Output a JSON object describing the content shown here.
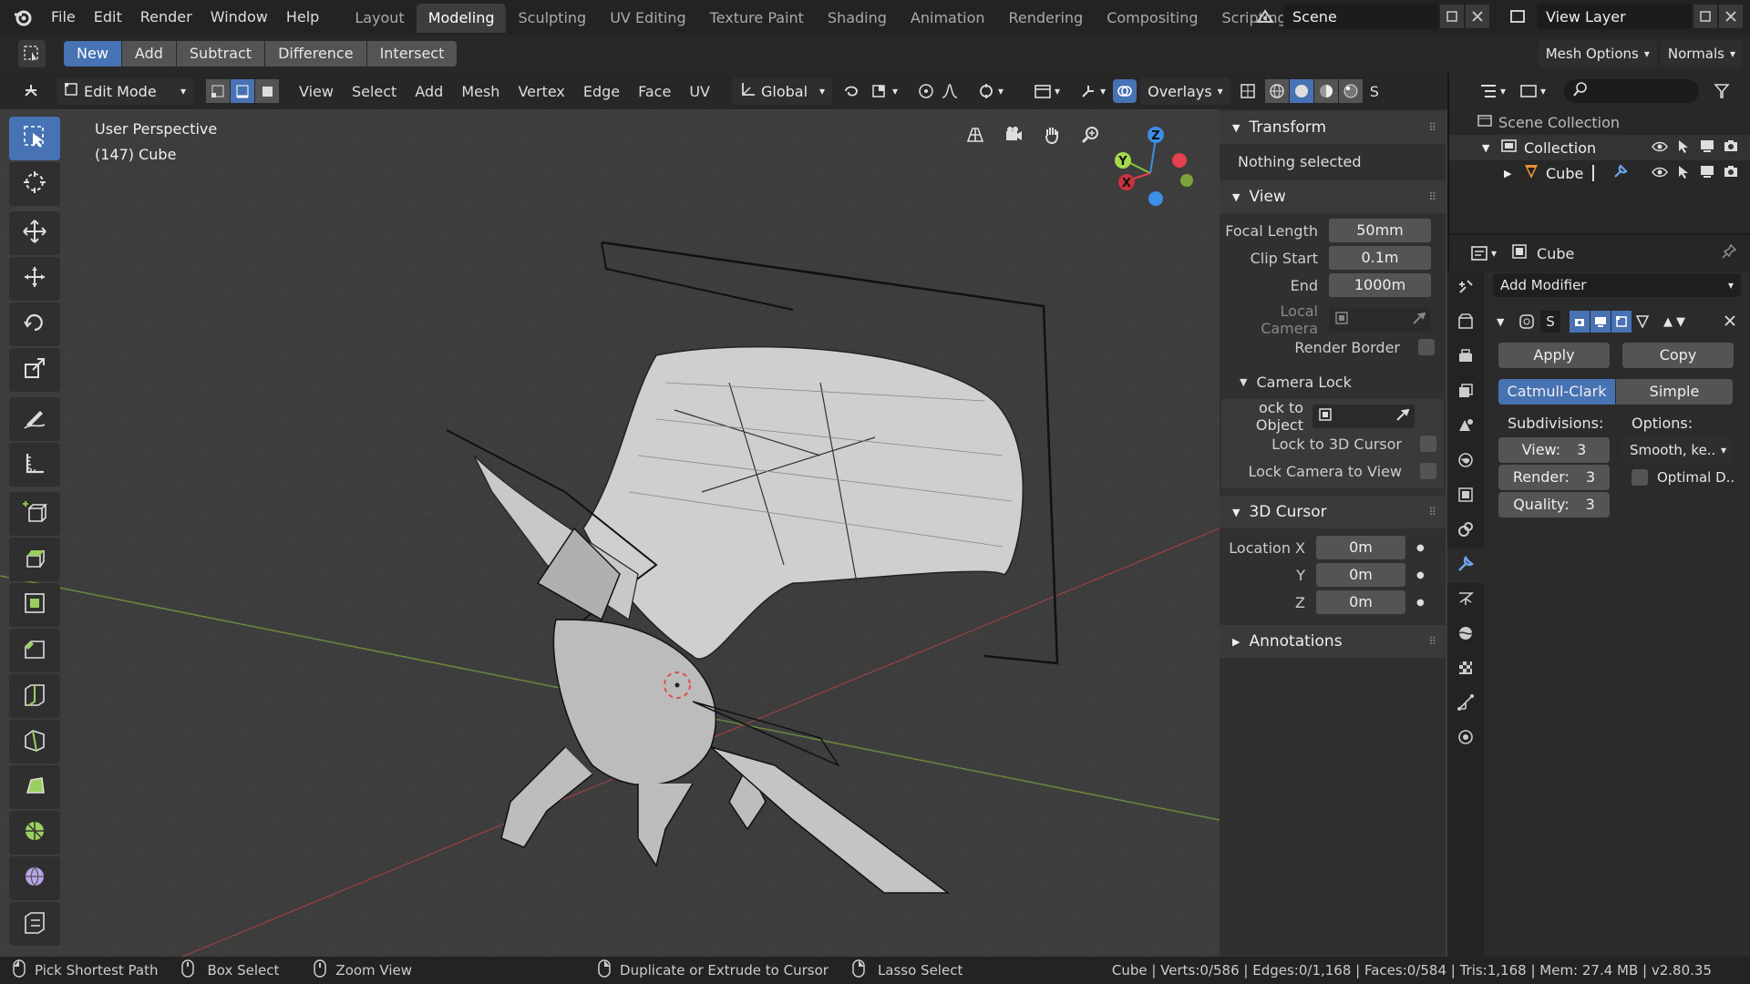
{
  "topbar": {
    "menus": [
      "File",
      "Edit",
      "Render",
      "Window",
      "Help"
    ],
    "workspaces": [
      "Layout",
      "Modeling",
      "Sculpting",
      "UV Editing",
      "Texture Paint",
      "Shading",
      "Animation",
      "Rendering",
      "Compositing",
      "Scripting"
    ],
    "active_workspace": "Modeling",
    "scene": "Scene",
    "view_layer": "View Layer"
  },
  "tool_header": {
    "modes": [
      "New",
      "Add",
      "Subtract",
      "Difference",
      "Intersect"
    ],
    "active_mode": "New",
    "mesh_options": "Mesh Options",
    "normals": "Normals"
  },
  "viewport_header": {
    "mode": "Edit Mode",
    "menus": [
      "View",
      "Select",
      "Add",
      "Mesh",
      "Vertex",
      "Edge",
      "Face",
      "UV"
    ],
    "orientation": "Global",
    "overlays": "Overlays",
    "trunc_label": "S"
  },
  "viewport": {
    "view_name": "User Perspective",
    "object_info": "(147) Cube",
    "gizmo": {
      "z": "Z",
      "y": "Y",
      "x": "X"
    }
  },
  "npanel": {
    "transform": {
      "title": "Transform",
      "empty_text": "Nothing selected"
    },
    "view": {
      "title": "View",
      "focal_length_label": "Focal Length",
      "focal_length": "50mm",
      "clip_start_label": "Clip Start",
      "clip_start": "0.1m",
      "clip_end_label": "End",
      "clip_end": "1000m",
      "local_camera_label": "Local Camera",
      "render_border_label": "Render Border"
    },
    "camera_lock": {
      "title": "Camera Lock",
      "lock_to_object_label": "ock to Object",
      "lock_3d_cursor_label": "Lock to 3D Cursor",
      "lock_camera_view_label": "Lock Camera to View"
    },
    "cursor": {
      "title": "3D Cursor",
      "x_label": "Location X",
      "x": "0m",
      "y_label": "Y",
      "y": "0m",
      "z_label": "Z",
      "z": "0m"
    },
    "annotations": {
      "title": "Annotations"
    }
  },
  "outliner": {
    "scene_collection": "Scene Collection",
    "collection": "Collection",
    "object": "Cube"
  },
  "properties": {
    "object_name": "Cube",
    "add_modifier": "Add Modifier",
    "modifier_name": "S",
    "apply": "Apply",
    "copy": "Copy",
    "types": [
      "Catmull-Clark",
      "Simple"
    ],
    "active_type": "Catmull-Clark",
    "subdivisions_label": "Subdivisions:",
    "options_label": "Options:",
    "view_label": "View:",
    "view_value": "3",
    "render_label": "Render:",
    "render_value": "3",
    "quality_label": "Quality:",
    "quality_value": "3",
    "smooth_option": "Smooth, ke..",
    "optimal_label": "Optimal D.."
  },
  "statusbar": {
    "items": [
      "Pick Shortest Path",
      "Box Select",
      "Zoom View",
      "Duplicate or Extrude to Cursor",
      "Lasso Select"
    ],
    "stats": "Cube | Verts:0/586 | Edges:0/1,168 | Faces:0/584 | Tris:1,168 | Mem: 27.4 MB | v2.80.35"
  },
  "colors": {
    "accent": "#4772b3",
    "x_axis": "#e5404f",
    "y_axis": "#8bc53f",
    "z_axis": "#3c8ee8"
  }
}
